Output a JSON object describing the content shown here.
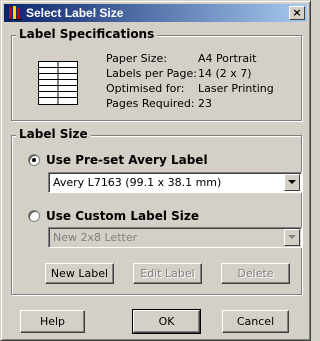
{
  "window": {
    "title": "Select Label Size"
  },
  "specifications": {
    "title": "Label Specifications",
    "rows": [
      {
        "label": "Paper Size:",
        "value": "A4 Portrait"
      },
      {
        "label": "Labels per Page:",
        "value": "14 (2 x 7)"
      },
      {
        "label": "Optimised for:",
        "value": "Laser Printing"
      },
      {
        "label": "Pages Required:",
        "value": "23"
      }
    ]
  },
  "label_size": {
    "title": "Label Size",
    "preset_option": {
      "label": "Use Pre-set Avery Label",
      "checked": true,
      "selected_value": "Avery L7163 (99.1 x 38.1 mm)"
    },
    "custom_option": {
      "label": "Use Custom Label Size",
      "checked": false,
      "selected_value": "New 2x8 Letter"
    },
    "buttons": {
      "new_label": "New Label",
      "edit_label": "Edit Label",
      "delete": "Delete"
    }
  },
  "footer": {
    "help": "Help",
    "ok": "OK",
    "cancel": "Cancel"
  },
  "icons": {
    "close": "close-icon",
    "app": "app-icon",
    "sheet": "label-sheet-icon"
  },
  "colors": {
    "titlebar_start": "#0a246a",
    "titlebar_end": "#a6caf0",
    "face": "#d4d0c8"
  }
}
